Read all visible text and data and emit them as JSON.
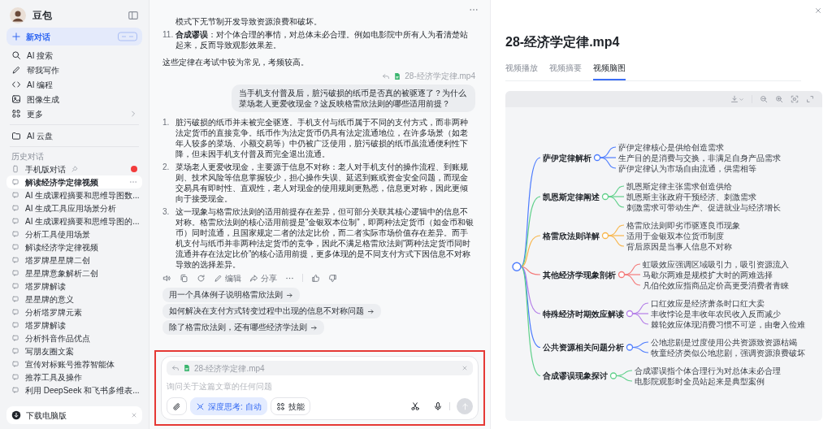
{
  "sidebar": {
    "app_name": "豆包",
    "new_chat": {
      "label": "新对话"
    },
    "menu": [
      {
        "kind": "search",
        "label": "AI 搜索"
      },
      {
        "kind": "write",
        "label": "帮我写作"
      },
      {
        "kind": "code",
        "label": "AI 编程"
      },
      {
        "kind": "image",
        "label": "图像生成"
      },
      {
        "kind": "more",
        "label": "更多"
      }
    ],
    "cloud": {
      "label": "AI 云盘"
    },
    "history_heading": "历史对话",
    "history": [
      {
        "kind": "mobile",
        "label": "手机版对话",
        "pinned": true,
        "unread": true,
        "selected": false
      },
      {
        "kind": "chat",
        "label": "解读经济学定律视频",
        "selected": true
      },
      {
        "kind": "chat",
        "label": "AI 生成课程摘要和思维导图数...",
        "selected": false
      },
      {
        "kind": "chat",
        "label": "AI 生成工具应用场景分析",
        "selected": false
      },
      {
        "kind": "chat",
        "label": "AI 生成课程摘要和思维导图的...",
        "selected": false
      },
      {
        "kind": "chat",
        "label": "分析工具使用场景",
        "selected": false
      },
      {
        "kind": "chat",
        "label": "解读经济学定律视频",
        "selected": false
      },
      {
        "kind": "chat",
        "label": "塔罗牌星星牌二创",
        "selected": false
      },
      {
        "kind": "chat",
        "label": "星星牌意象解析二创",
        "selected": false
      },
      {
        "kind": "chat",
        "label": "塔罗牌解读",
        "selected": false
      },
      {
        "kind": "chat",
        "label": "星星牌的意义",
        "selected": false
      },
      {
        "kind": "chat",
        "label": "分析塔罗牌元素",
        "selected": false
      },
      {
        "kind": "chat",
        "label": "塔罗牌解读",
        "selected": false
      },
      {
        "kind": "chat",
        "label": "分析抖音作品优点",
        "selected": false
      },
      {
        "kind": "chat",
        "label": "写朋友圈文案",
        "selected": false
      },
      {
        "kind": "chat",
        "label": "宣传对标账号推荐智能体",
        "selected": false
      },
      {
        "kind": "chat",
        "label": "推荐工具及操作",
        "selected": false
      },
      {
        "kind": "chat",
        "label": "利用 DeepSeek 和飞书多维表...",
        "selected": false
      }
    ],
    "download": {
      "label": "下载电脑版"
    }
  },
  "chat": {
    "previous_answer": {
      "continuation": "模式下无节制开发导致资源浪费和破坏。",
      "items": [
        {
          "number": "11.",
          "text": "**合成谬误**：对个体合理的事情，对总体未必合理。例如电影院中所有人为看清楚站起来，反而导致观影效果差。"
        }
      ],
      "closing": "这些定律在考试中较为常见，考频较高。"
    },
    "question": {
      "attachment": "28-经济学定律.mp4",
      "text": "当手机支付普及后，脏污破损的纸币是否真的被驱逐了？为什么菜场老人更爱收现金？这反映格雷欣法则的哪些适用前提？"
    },
    "answer": {
      "items": [
        {
          "number": "1.",
          "text": "脏污破损的纸币并未被完全驱逐。手机支付与纸币属于不同的支付方式，而非两种法定货币的直接竞争。纸币作为法定货币仍具有法定流通地位，在许多场景（如老年人较多的菜场、小额交易等）中仍被广泛使用，脏污破损的纸币虽流通便利性下降，但未因手机支付普及而完全退出流通。"
        },
        {
          "number": "2.",
          "text": "菜场老人更爱收现金，主要源于信息不对称：老人对手机支付的操作流程、到账规则、技术风险等信息掌握较少，担心操作失误、延迟到账或资金安全问题，而现金交易具有即时性、直观性，老人对现金的使用规则更熟悉，信息更对称，因此更倾向于接受现金。"
        },
        {
          "number": "3.",
          "text": "这一现象与格雷欣法则的适用前提存在差异，但可部分关联其核心逻辑中的信息不对称。格雷欣法则的核心适用前提是“金银双本位制”，即两种法定货币（如金币和银币）同时流通，且国家规定二者的法定比价，而二者实际市场价值存在差异。而手机支付与纸币并非两种法定货币的竞争，因此不满足格雷欣法则“两种法定货币同时流通并存在法定比价”的核心适用前提，更多体现的是不同支付方式下因信息不对称导致的选择差异。"
        }
      ],
      "actions": [
        {
          "kind": "speak"
        },
        {
          "kind": "copy"
        },
        {
          "kind": "regenerate"
        },
        {
          "kind": "edit",
          "label": "编辑"
        },
        {
          "kind": "share",
          "label": "分享"
        },
        {
          "kind": "more"
        },
        {
          "kind": "like"
        },
        {
          "kind": "dislike"
        }
      ]
    },
    "suggestions": [
      "用一个具体例子说明格雷欣法则",
      "如何解决在支付方式转变过程中出现的信息不对称问题",
      "除了格雷欣法则，还有哪些经济学法则"
    ],
    "composer": {
      "highlighted": true,
      "attachment": "28-经济学定律.mp4",
      "placeholder": "询问关于这篇文章的任何问题",
      "tools": [
        {
          "kind": "attach"
        },
        {
          "kind": "deep_think",
          "label": "深度思考: 自动",
          "selected": true
        },
        {
          "kind": "skills",
          "label": "技能"
        }
      ]
    }
  },
  "preview": {
    "title": "28-经济学定律.mp4",
    "tabs": [
      {
        "label": "视频播放",
        "selected": false
      },
      {
        "label": "视频摘要",
        "selected": false
      },
      {
        "label": "视频脑图",
        "selected": true
      }
    ],
    "mind_map": {
      "branches": [
        {
          "label": "萨伊定律解析",
          "color": "#4d7cfe",
          "children": [
            {
              "label": "萨伊定律核心是供给创造需求"
            },
            {
              "label": "生产目的是消费与交换，非满足自身产品需求"
            },
            {
              "label": "萨伊定律认为市场自由流通，供需相等"
            }
          ]
        },
        {
          "label": "凯恩斯定律阐述",
          "color": "#5fd08a",
          "children": [
            {
              "label": "凯恩斯定律主张需求创造供给"
            },
            {
              "label": "凯恩斯主张政府干预经济、刺激需求"
            },
            {
              "label": "刺激需求可带动生产、促进就业与经济增长"
            }
          ]
        },
        {
          "label": "格雷欣法则详解",
          "color": "#f8b64c",
          "children": [
            {
              "label": "格雷欣法则即劣币驱逐良币现象"
            },
            {
              "label": "适用于金银双本位货币制度"
            },
            {
              "label": "背后原因是当事人信息不对称"
            }
          ]
        },
        {
          "label": "其他经济学现象剖析",
          "color": "#f47a7a",
          "children": [
            {
              "label": "虹吸效应强调区域吸引力，吸引资源流入"
            },
            {
              "label": "马歇尔两难是规模扩大时的两难选择"
            },
            {
              "label": "凡伯伦效应指商品定价高更受消费者青睐"
            }
          ]
        },
        {
          "label": "特殊经济时期效应解读",
          "color": "#b47ee8",
          "children": [
            {
              "label": "口红效应是经济萧条时口红大卖"
            },
            {
              "label": "丰收悖论是丰收年农民收入反而减少"
            },
            {
              "label": "棘轮效应体现消费习惯不可逆，由奢入俭难"
            }
          ]
        },
        {
          "label": "公共资源相关问题分析",
          "color": "#4d7cfe",
          "children": [
            {
              "label": "公地悲剧是过度使用公共资源致资源枯竭"
            },
            {
              "label": "牧童经济类似公地悲剧，强调资源浪费破坏"
            }
          ]
        },
        {
          "label": "合成谬误现象探讨",
          "color": "#5fd08a",
          "children": [
            {
              "label": "合成谬误指个体合理行为对总体未必合理"
            },
            {
              "label": "电影院观影时全员站起来是典型案例"
            }
          ]
        }
      ]
    }
  }
}
